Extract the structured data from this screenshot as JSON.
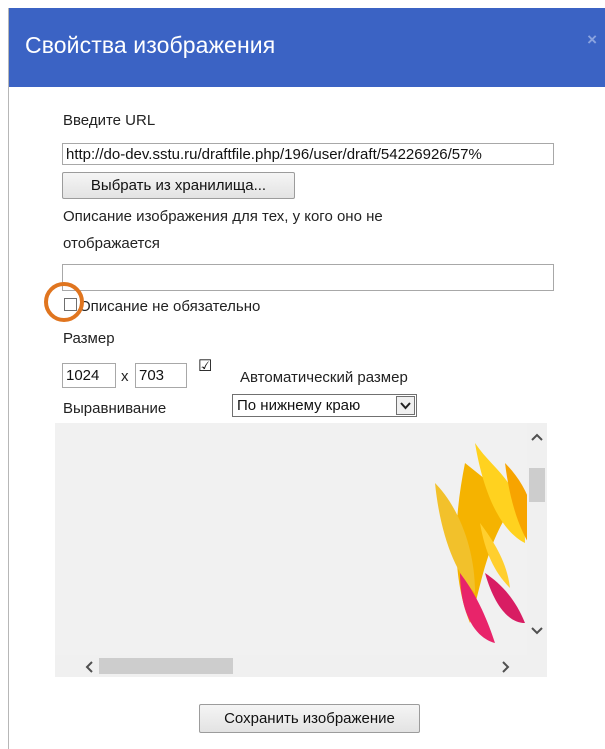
{
  "dialog": {
    "title": "Свойства изображения",
    "close_glyph": "×",
    "url_label": "Введите URL",
    "url_value": "http://do-dev.sstu.ru/draftfile.php/196/user/draft/54226926/57%",
    "browse_button": "Выбрать из хранилища...",
    "alt_label_line1": "Описание изображения для тех, у кого оно не",
    "alt_label_line2": "отображается",
    "alt_value": "",
    "alt_optional_checkbox_label": "Описание не обязательно",
    "alt_optional_checked": false,
    "size_label": "Размер",
    "width_value": "1024",
    "size_separator": "x",
    "height_value": "703",
    "auto_size_checked": true,
    "auto_size_label": "Автоматический размер",
    "align_label": "Выравнивание",
    "align_selected": "По нижнему краю",
    "save_button": "Сохранить изображение"
  },
  "colors": {
    "titlebar": "#3b63c4",
    "highlight_ring": "#e0751f"
  }
}
